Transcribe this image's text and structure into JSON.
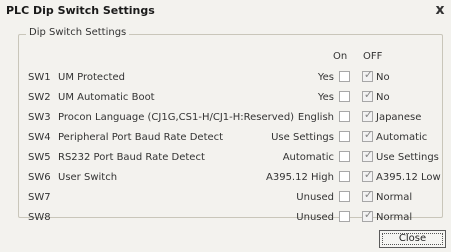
{
  "window": {
    "title": "PLC Dip Switch Settings",
    "close_glyph": "x"
  },
  "group": {
    "title": "Dip Switch Settings",
    "col_on": "On",
    "col_off": "OFF"
  },
  "rows": [
    {
      "sw": "SW1",
      "desc": "UM Protected",
      "on_label": "Yes",
      "on_checked": false,
      "off_checked": true,
      "off_label": "No"
    },
    {
      "sw": "SW2",
      "desc": "UM Automatic Boot",
      "on_label": "Yes",
      "on_checked": false,
      "off_checked": true,
      "off_label": "No"
    },
    {
      "sw": "SW3",
      "desc": "Procon Language (CJ1G,CS1-H/CJ1-H:Reserved)",
      "on_label": "English",
      "on_checked": false,
      "off_checked": true,
      "off_label": "Japanese"
    },
    {
      "sw": "SW4",
      "desc": "Peripheral Port Baud Rate Detect",
      "on_label": "Use Settings",
      "on_checked": false,
      "off_checked": true,
      "off_label": "Automatic"
    },
    {
      "sw": "SW5",
      "desc": "RS232 Port Baud Rate Detect",
      "on_label": "Automatic",
      "on_checked": false,
      "off_checked": true,
      "off_label": "Use Settings"
    },
    {
      "sw": "SW6",
      "desc": "User Switch",
      "on_label": "A395.12 High",
      "on_checked": false,
      "off_checked": true,
      "off_label": "A395.12 Low"
    },
    {
      "sw": "SW7",
      "desc": "",
      "on_label": "Unused",
      "on_checked": false,
      "off_checked": true,
      "off_label": "Normal"
    },
    {
      "sw": "SW8",
      "desc": "",
      "on_label": "Unused",
      "on_checked": false,
      "off_checked": true,
      "off_label": "Normal"
    }
  ],
  "buttons": {
    "close_label": "Close"
  }
}
